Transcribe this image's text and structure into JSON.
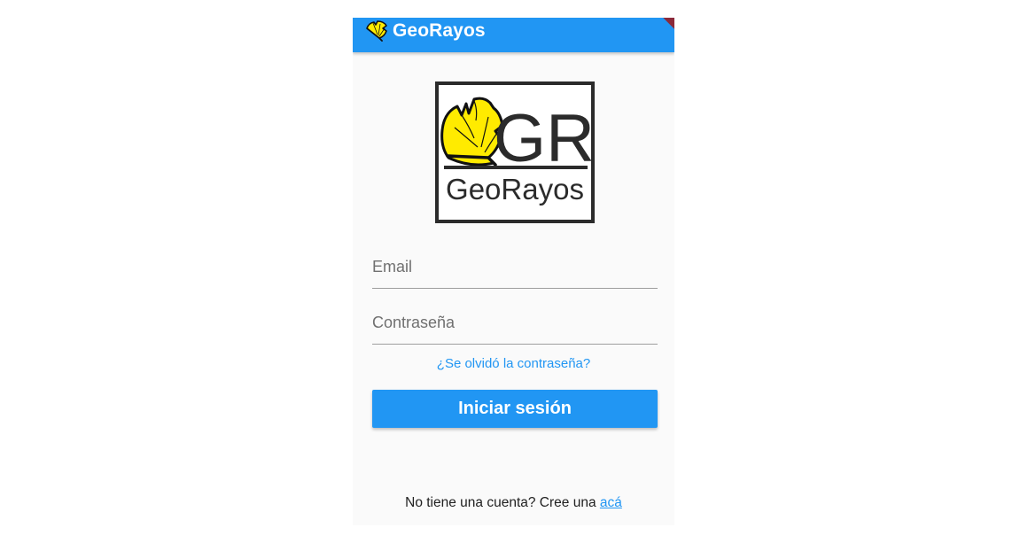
{
  "appbar": {
    "title": "GeoRayos",
    "icon": "ginkgo-leaf-icon"
  },
  "logo": {
    "monogram": "GR",
    "wordmark": "GeoRayos",
    "leaf_color": "#ffeb00"
  },
  "form": {
    "email_placeholder": "Email",
    "email_value": "",
    "password_placeholder": "Contraseña",
    "password_value": "",
    "forgot_label": "¿Se olvidó la contraseña?",
    "login_label": "Iniciar sesión"
  },
  "signup": {
    "prompt": "No tiene una cuenta? Cree una ",
    "link_label": "acá"
  },
  "colors": {
    "primary": "#2196f3",
    "background": "#fafafa",
    "debug_banner": "#8b2a3a"
  }
}
